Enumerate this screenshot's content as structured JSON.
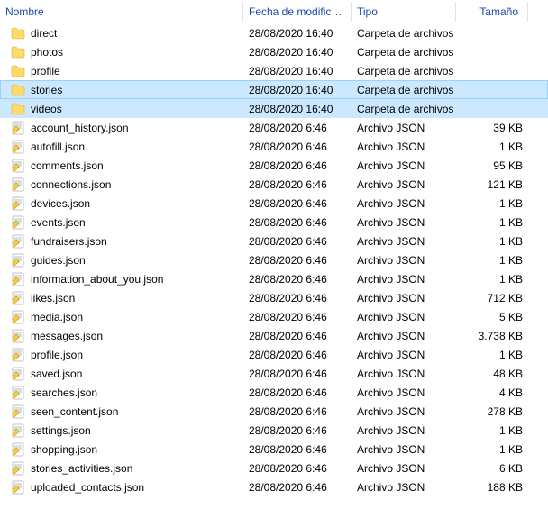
{
  "columns": {
    "name": "Nombre",
    "date": "Fecha de modifica...",
    "type": "Tipo",
    "size": "Tamaño"
  },
  "rows": [
    {
      "icon": "folder",
      "name": "direct",
      "date": "28/08/2020 16:40",
      "type": "Carpeta de archivos",
      "size": "",
      "selected": false
    },
    {
      "icon": "folder",
      "name": "photos",
      "date": "28/08/2020 16:40",
      "type": "Carpeta de archivos",
      "size": "",
      "selected": false
    },
    {
      "icon": "folder",
      "name": "profile",
      "date": "28/08/2020 16:40",
      "type": "Carpeta de archivos",
      "size": "",
      "selected": false
    },
    {
      "icon": "folder",
      "name": "stories",
      "date": "28/08/2020 16:40",
      "type": "Carpeta de archivos",
      "size": "",
      "selected": true,
      "outline": true
    },
    {
      "icon": "folder",
      "name": "videos",
      "date": "28/08/2020 16:40",
      "type": "Carpeta de archivos",
      "size": "",
      "selected": true
    },
    {
      "icon": "json",
      "name": "account_history.json",
      "date": "28/08/2020 6:46",
      "type": "Archivo JSON",
      "size": "39 KB"
    },
    {
      "icon": "json",
      "name": "autofill.json",
      "date": "28/08/2020 6:46",
      "type": "Archivo JSON",
      "size": "1 KB"
    },
    {
      "icon": "json",
      "name": "comments.json",
      "date": "28/08/2020 6:46",
      "type": "Archivo JSON",
      "size": "95 KB"
    },
    {
      "icon": "json",
      "name": "connections.json",
      "date": "28/08/2020 6:46",
      "type": "Archivo JSON",
      "size": "121 KB"
    },
    {
      "icon": "json",
      "name": "devices.json",
      "date": "28/08/2020 6:46",
      "type": "Archivo JSON",
      "size": "1 KB"
    },
    {
      "icon": "json",
      "name": "events.json",
      "date": "28/08/2020 6:46",
      "type": "Archivo JSON",
      "size": "1 KB"
    },
    {
      "icon": "json",
      "name": "fundraisers.json",
      "date": "28/08/2020 6:46",
      "type": "Archivo JSON",
      "size": "1 KB"
    },
    {
      "icon": "json",
      "name": "guides.json",
      "date": "28/08/2020 6:46",
      "type": "Archivo JSON",
      "size": "1 KB"
    },
    {
      "icon": "json",
      "name": "information_about_you.json",
      "date": "28/08/2020 6:46",
      "type": "Archivo JSON",
      "size": "1 KB"
    },
    {
      "icon": "json",
      "name": "likes.json",
      "date": "28/08/2020 6:46",
      "type": "Archivo JSON",
      "size": "712 KB"
    },
    {
      "icon": "json",
      "name": "media.json",
      "date": "28/08/2020 6:46",
      "type": "Archivo JSON",
      "size": "5 KB"
    },
    {
      "icon": "json",
      "name": "messages.json",
      "date": "28/08/2020 6:46",
      "type": "Archivo JSON",
      "size": "3.738 KB"
    },
    {
      "icon": "json",
      "name": "profile.json",
      "date": "28/08/2020 6:46",
      "type": "Archivo JSON",
      "size": "1 KB"
    },
    {
      "icon": "json",
      "name": "saved.json",
      "date": "28/08/2020 6:46",
      "type": "Archivo JSON",
      "size": "48 KB"
    },
    {
      "icon": "json",
      "name": "searches.json",
      "date": "28/08/2020 6:46",
      "type": "Archivo JSON",
      "size": "4 KB"
    },
    {
      "icon": "json",
      "name": "seen_content.json",
      "date": "28/08/2020 6:46",
      "type": "Archivo JSON",
      "size": "278 KB"
    },
    {
      "icon": "json",
      "name": "settings.json",
      "date": "28/08/2020 6:46",
      "type": "Archivo JSON",
      "size": "1 KB"
    },
    {
      "icon": "json",
      "name": "shopping.json",
      "date": "28/08/2020 6:46",
      "type": "Archivo JSON",
      "size": "1 KB"
    },
    {
      "icon": "json",
      "name": "stories_activities.json",
      "date": "28/08/2020 6:46",
      "type": "Archivo JSON",
      "size": "6 KB"
    },
    {
      "icon": "json",
      "name": "uploaded_contacts.json",
      "date": "28/08/2020 6:46",
      "type": "Archivo JSON",
      "size": "188 KB"
    }
  ]
}
